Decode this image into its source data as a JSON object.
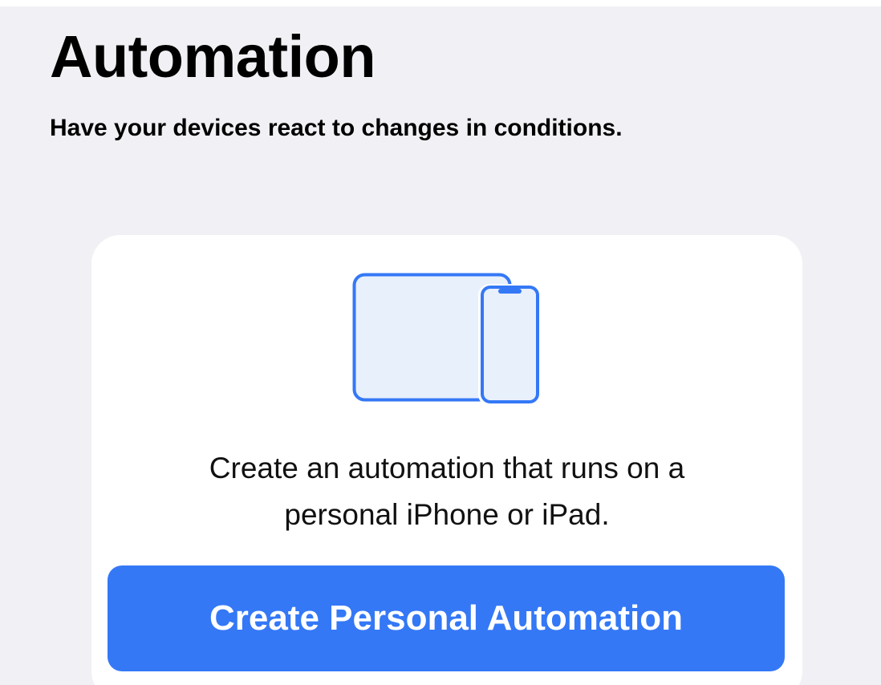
{
  "header": {
    "title": "Automation",
    "subtitle": "Have your devices react to changes in conditions."
  },
  "personal_card": {
    "illustration_icon": "ipad-and-iphone-icon",
    "description_lines": [
      "Create an automation that runs on a",
      "personal iPhone or iPad."
    ],
    "button_label": "Create Personal Automation"
  },
  "colors": {
    "background": "#f1f1f5",
    "card": "#ffffff",
    "accent": "#3478f6",
    "illustration_fill": "#e8f0fc",
    "text": "#000000"
  }
}
